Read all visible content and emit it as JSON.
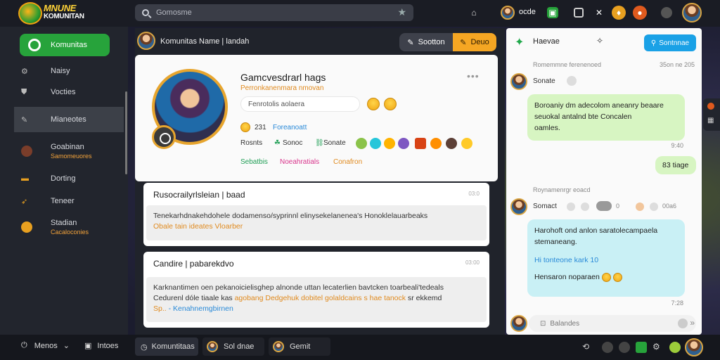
{
  "app": {
    "logo_line1": "MNUNE",
    "logo_line2": "KOMUNITAN"
  },
  "search": {
    "placeholder": "Gomosme"
  },
  "topbar": {
    "username": "ocde"
  },
  "sidebar": {
    "items": [
      {
        "label": "Komunitas",
        "icon": "circle-icon"
      },
      {
        "label": "Naisy",
        "icon": "gear-icon"
      },
      {
        "label": "Vocties",
        "icon": "shield-icon"
      },
      {
        "label": "Mianeotes",
        "icon": "pencil-icon"
      },
      {
        "label": "Goabinan",
        "sub": "Samomeuores",
        "icon": "avatar-icon"
      },
      {
        "label": "Dorting",
        "icon": "chest-icon"
      },
      {
        "label": "Teneer",
        "icon": "arrow-icon"
      },
      {
        "label": "Stadian",
        "sub": "Cacaloconies",
        "icon": "medal-icon"
      }
    ]
  },
  "main": {
    "header_title": "Komunitas   Name | landah",
    "btn_a": "Sootton",
    "btn_b": "Deuo",
    "profile": {
      "name": "Gamcvesdrarl hags",
      "subtitle": "Perronkanenmara nmovan",
      "input_value": "Fenrotolis aolaera",
      "stat1_num": "231",
      "stat1_label": "Foreanoatt",
      "stat2_label": "Rosnts",
      "stat3_label": "Sonoc",
      "stat4_label": "Sonate",
      "tag1": "Sebatbis",
      "tag2": "Noeahratials",
      "tag3": "Conafron"
    },
    "cards": [
      {
        "title": "Rusocrailyrlsleian | baad",
        "time": "03:0",
        "body_line1": "Tenekarhdnakehdohele dodamenso/syprinnl elinysekelanenea's Honoklelauarbeaks",
        "body_line2": "Obale tain ideates Vloarber"
      },
      {
        "title": "Candire | pabarekdvo",
        "time": "03:00",
        "body_line1": "Karknantimen oen pekanoicielisghep alnonde uttan lecaterlien bavtcken toarbeali'tedeals",
        "body_line2_a": "Cedurenl dóle tiaale kas",
        "body_line2_b": "agobang Dedgehuk dobitel golaldcains s hae tanock",
        "body_line2_c": "sr ekkemd",
        "body_line3_a": "Sp..",
        "body_line3_b": "- Kenahnemgbirnen"
      }
    ]
  },
  "chat": {
    "title": "Haevae",
    "new_btn": "Sontnnae",
    "meta1": "Romemmne ferenenoed",
    "meta1_time": "35on ne 205",
    "user1": "Sonate",
    "msg1": "Boroaniy dm adecolom aneanry beaare seuokal antalnd bte Concalen",
    "msg1_b": "oamles.",
    "msg1_time": "9:40",
    "msg2": "83 tiage",
    "meta2": "Roynamenrgr eoacd",
    "user2": "Somact",
    "user2_extra1": "0",
    "user2_extra2": "00a6",
    "msg3_line1": "Harohoft ond anlon saratolecampaela",
    "msg3_line2": "stemaneang.",
    "msg3_line3": "Hi tonteone kark 10",
    "msg3_line4": "Hensaron noparaen",
    "msg3_time": "7:28",
    "input_placeholder": "Balandes"
  },
  "bottombar": {
    "item1": "Menos",
    "item2": "Intoes",
    "item3": "Komuntitaas",
    "item4": "Sol dnae",
    "item5": "Gemit"
  },
  "colors": {
    "accent_green": "#27a33b",
    "accent_orange": "#f5a623",
    "accent_blue": "#1aa1e6"
  }
}
